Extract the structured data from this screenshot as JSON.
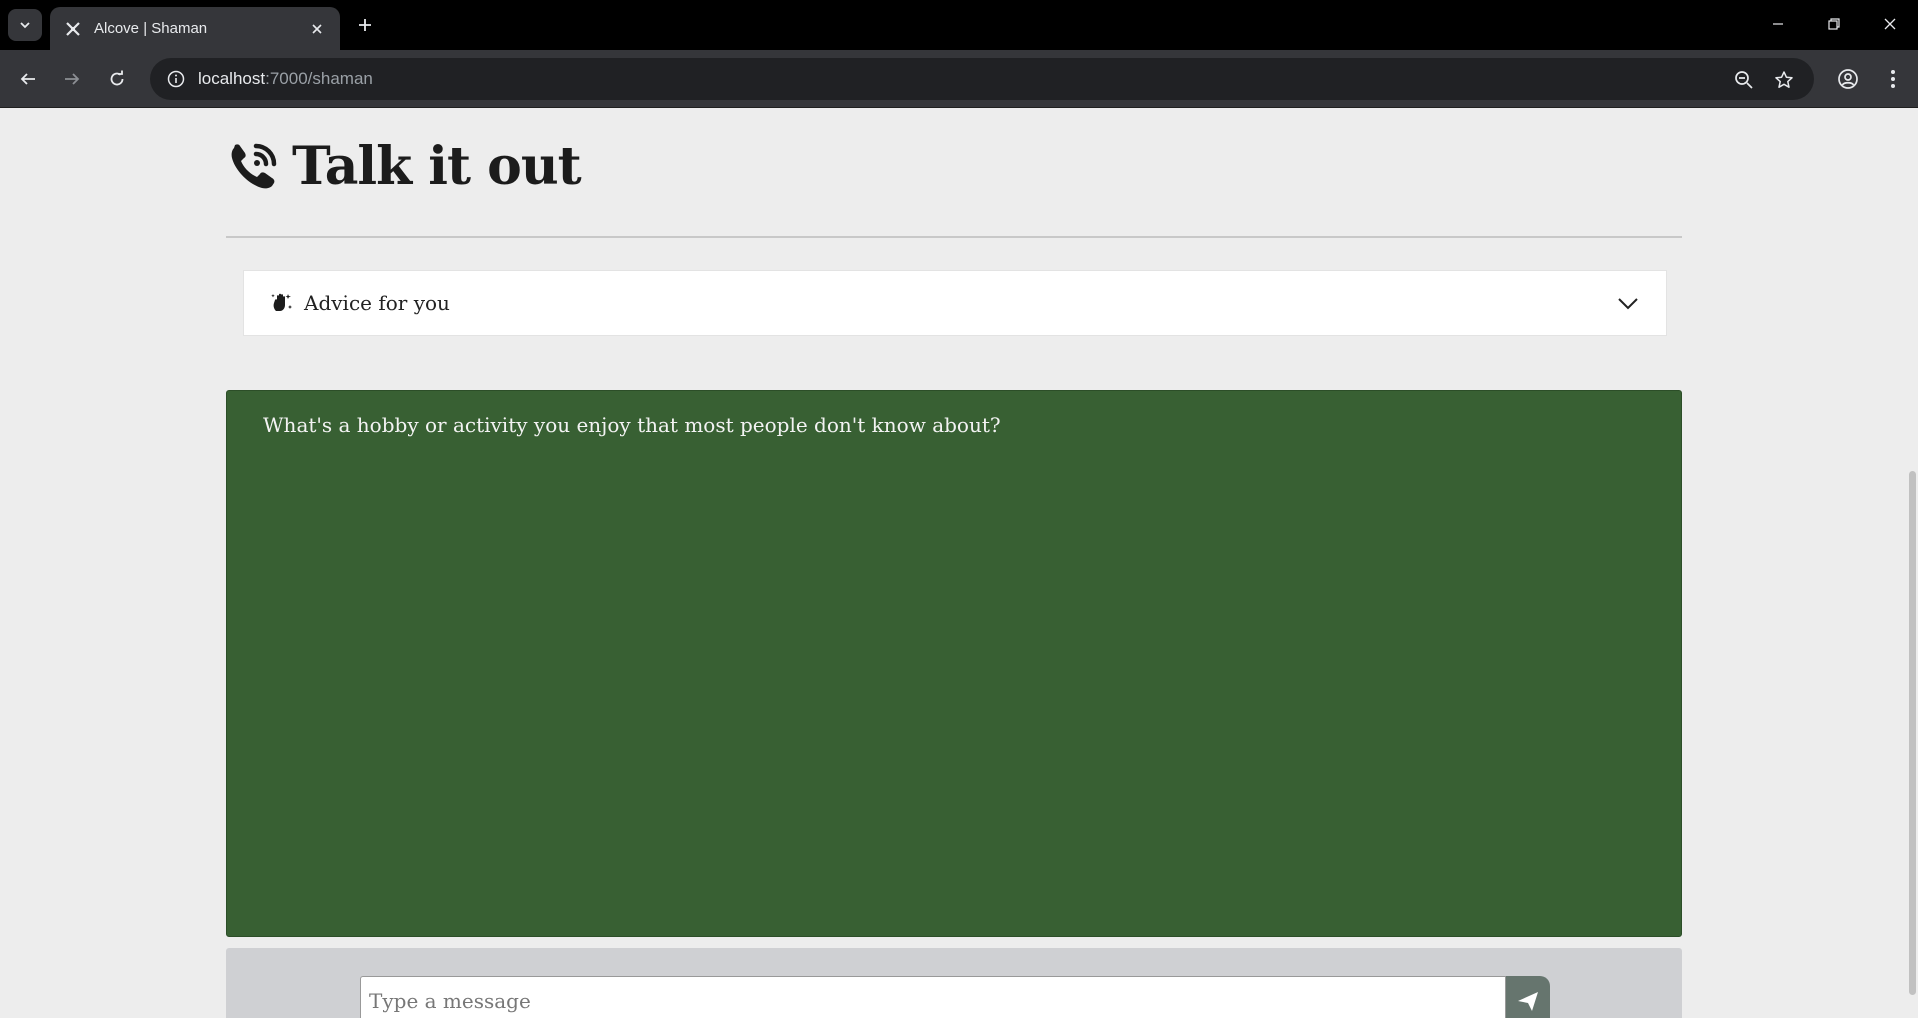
{
  "browser": {
    "tab_title": "Alcove | Shaman",
    "url_host": "localhost",
    "url_path": ":7000/shaman"
  },
  "page": {
    "title": "Talk it out",
    "title_icon": "phone-volume-icon",
    "accordion": {
      "label": "Advice for you",
      "icon": "hand-sparkles-icon",
      "expanded": false
    },
    "prompt": "What's a hobby or activity you enjoy that most people don't know about?",
    "input": {
      "placeholder": "Type a message",
      "value": ""
    }
  },
  "colors": {
    "prompt_bg": "#386033",
    "page_bg": "#ededed",
    "send_button": "#66756e"
  }
}
